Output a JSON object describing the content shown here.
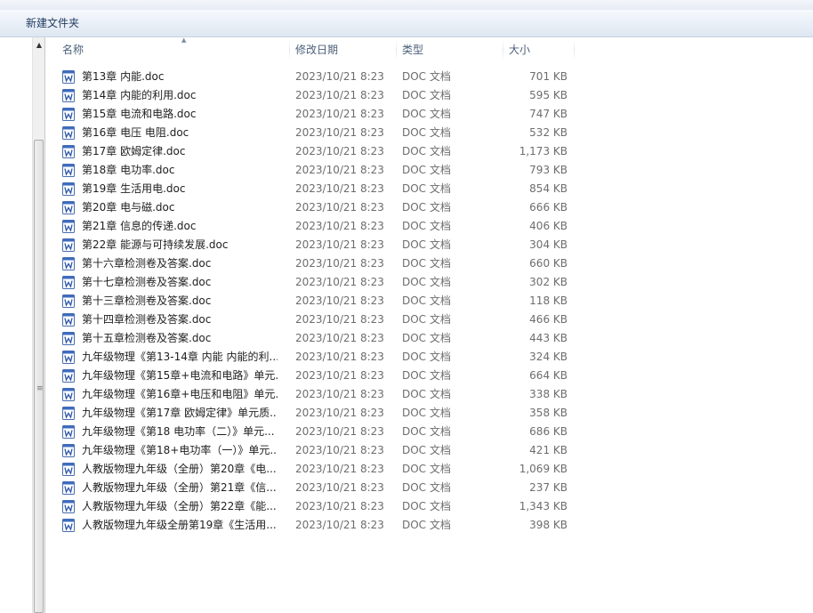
{
  "toolbar": {
    "new_folder": "新建文件夹"
  },
  "columns": {
    "name": "名称",
    "date": "修改日期",
    "type": "类型",
    "size": "大小"
  },
  "icon": "word-document-icon",
  "files": [
    {
      "name": "第13章 内能.doc",
      "date": "2023/10/21 8:23",
      "type": "DOC 文档",
      "size": "701 KB"
    },
    {
      "name": "第14章 内能的利用.doc",
      "date": "2023/10/21 8:23",
      "type": "DOC 文档",
      "size": "595 KB"
    },
    {
      "name": "第15章 电流和电路.doc",
      "date": "2023/10/21 8:23",
      "type": "DOC 文档",
      "size": "747 KB"
    },
    {
      "name": "第16章 电压 电阻.doc",
      "date": "2023/10/21 8:23",
      "type": "DOC 文档",
      "size": "532 KB"
    },
    {
      "name": "第17章 欧姆定律.doc",
      "date": "2023/10/21 8:23",
      "type": "DOC 文档",
      "size": "1,173 KB"
    },
    {
      "name": "第18章 电功率.doc",
      "date": "2023/10/21 8:23",
      "type": "DOC 文档",
      "size": "793 KB"
    },
    {
      "name": "第19章 生活用电.doc",
      "date": "2023/10/21 8:23",
      "type": "DOC 文档",
      "size": "854 KB"
    },
    {
      "name": "第20章 电与磁.doc",
      "date": "2023/10/21 8:23",
      "type": "DOC 文档",
      "size": "666 KB"
    },
    {
      "name": "第21章 信息的传递.doc",
      "date": "2023/10/21 8:23",
      "type": "DOC 文档",
      "size": "406 KB"
    },
    {
      "name": "第22章 能源与可持续发展.doc",
      "date": "2023/10/21 8:23",
      "type": "DOC 文档",
      "size": "304 KB"
    },
    {
      "name": "第十六章检测卷及答案.doc",
      "date": "2023/10/21 8:23",
      "type": "DOC 文档",
      "size": "660 KB"
    },
    {
      "name": "第十七章检测卷及答案.doc",
      "date": "2023/10/21 8:23",
      "type": "DOC 文档",
      "size": "302 KB"
    },
    {
      "name": "第十三章检测卷及答案.doc",
      "date": "2023/10/21 8:23",
      "type": "DOC 文档",
      "size": "118 KB"
    },
    {
      "name": "第十四章检测卷及答案.doc",
      "date": "2023/10/21 8:23",
      "type": "DOC 文档",
      "size": "466 KB"
    },
    {
      "name": "第十五章检测卷及答案.doc",
      "date": "2023/10/21 8:23",
      "type": "DOC 文档",
      "size": "443 KB"
    },
    {
      "name": "九年级物理《第13-14章 内能 内能的利...",
      "date": "2023/10/21 8:23",
      "type": "DOC 文档",
      "size": "324 KB"
    },
    {
      "name": "九年级物理《第15章+电流和电路》单元...",
      "date": "2023/10/21 8:23",
      "type": "DOC 文档",
      "size": "664 KB"
    },
    {
      "name": "九年级物理《第16章+电压和电阻》单元...",
      "date": "2023/10/21 8:23",
      "type": "DOC 文档",
      "size": "338 KB"
    },
    {
      "name": "九年级物理《第17章 欧姆定律》单元质...",
      "date": "2023/10/21 8:23",
      "type": "DOC 文档",
      "size": "358 KB"
    },
    {
      "name": "九年级物理《第18 电功率（二）》单元...",
      "date": "2023/10/21 8:23",
      "type": "DOC 文档",
      "size": "686 KB"
    },
    {
      "name": "九年级物理《第18+电功率（一）》单元...",
      "date": "2023/10/21 8:23",
      "type": "DOC 文档",
      "size": "421 KB"
    },
    {
      "name": "人教版物理九年级（全册）第20章《电...",
      "date": "2023/10/21 8:23",
      "type": "DOC 文档",
      "size": "1,069 KB"
    },
    {
      "name": "人教版物理九年级（全册）第21章《信...",
      "date": "2023/10/21 8:23",
      "type": "DOC 文档",
      "size": "237 KB"
    },
    {
      "name": "人教版物理九年级（全册）第22章《能...",
      "date": "2023/10/21 8:23",
      "type": "DOC 文档",
      "size": "1,343 KB"
    },
    {
      "name": "人教版物理九年级全册第19章《生活用...",
      "date": "2023/10/21 8:23",
      "type": "DOC 文档",
      "size": "398 KB"
    }
  ]
}
